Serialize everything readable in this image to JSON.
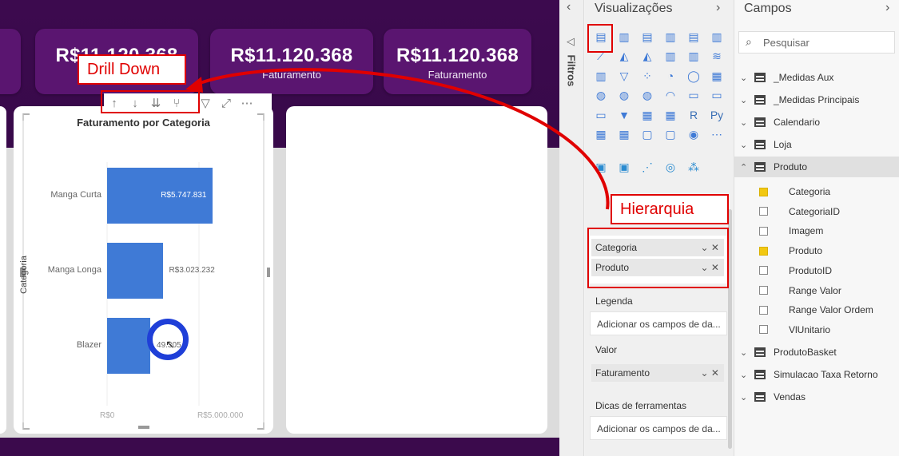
{
  "kpis": [
    {
      "value": "R$11.120.368",
      "label": ""
    },
    {
      "value": "R$11.120.368",
      "label": "Faturamento"
    },
    {
      "value": "R$11.120.368",
      "label": "Faturamento"
    }
  ],
  "annotations": {
    "drill_down": "Drill Down",
    "hierarquia": "Hierarquia",
    "colors": {
      "highlight": "#e00000",
      "bar": "#3f7ad6",
      "canvas": "#3c0a4e"
    }
  },
  "toolbar_icons": [
    "drill-up-icon",
    "drill-down-icon",
    "expand-all-icon",
    "expand-next-icon",
    "filter-icon",
    "focus-mode-icon",
    "more-options-icon"
  ],
  "chart_data": {
    "type": "bar",
    "title": "Faturamento por Categoria",
    "ylabel": "Categoria",
    "categories": [
      "Manga Curta",
      "Manga Longa",
      "Blazer"
    ],
    "values": [
      5747831,
      3023232,
      2349305
    ],
    "data_labels": [
      "R$5.747.831",
      "R$3.023.232",
      "R$2.349.305"
    ],
    "visible_data_labels": [
      "R$5.747.831",
      "R$3.023.232",
      "49.305"
    ],
    "xticks": [
      "R$0",
      "R$5.000.000"
    ],
    "xlim": [
      0,
      6000000
    ]
  },
  "viz_pane": {
    "title": "Visualizações",
    "filters_label": "Filtros",
    "wells": {
      "legenda_label": "Legenda",
      "legenda_placeholder": "Adicionar os campos de da...",
      "valor_label": "Valor",
      "valor_field": "Faturamento",
      "dicas_label": "Dicas de ferramentas",
      "dicas_placeholder": "Adicionar os campos de da...",
      "axis_fields": [
        "Categoria",
        "Produto"
      ]
    }
  },
  "fields_pane": {
    "title": "Campos",
    "search_placeholder": "Pesquisar",
    "tables": [
      {
        "name": "_Medidas Aux",
        "type": "measure"
      },
      {
        "name": "_Medidas Principais",
        "type": "measure"
      },
      {
        "name": "Calendario",
        "type": "table"
      },
      {
        "name": "Loja",
        "type": "table"
      },
      {
        "name": "Produto",
        "type": "table",
        "expanded": true
      }
    ],
    "produto_fields": [
      {
        "name": "Categoria",
        "checked": true
      },
      {
        "name": "CategoriaID",
        "checked": false
      },
      {
        "name": "Imagem",
        "checked": false
      },
      {
        "name": "Produto",
        "checked": true
      },
      {
        "name": "ProdutoID",
        "checked": false
      },
      {
        "name": "Range Valor",
        "checked": false
      },
      {
        "name": "Range Valor Ordem",
        "checked": false
      },
      {
        "name": "VlUnitario",
        "checked": false
      }
    ],
    "tables_after": [
      "ProdutoBasket",
      "Simulacao Taxa Retorno",
      "Vendas"
    ]
  }
}
